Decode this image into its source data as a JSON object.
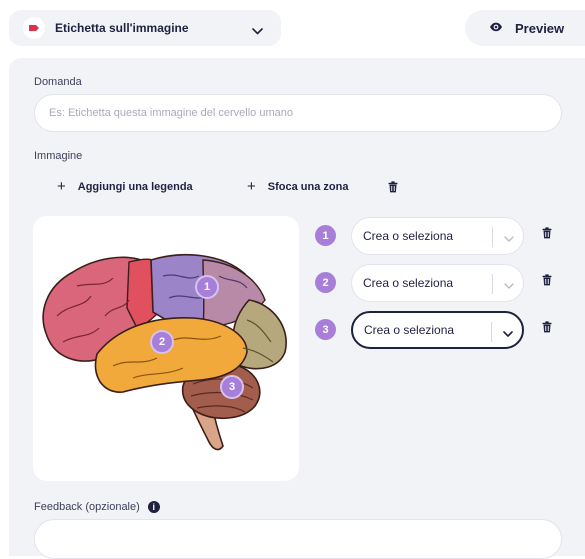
{
  "header": {
    "question_type": {
      "label": "Etichetta sull'immagine",
      "icon": "label-tag-icon"
    },
    "preview": {
      "label": "Preview",
      "icon": "eye-icon"
    }
  },
  "form": {
    "question_label": "Domanda",
    "question_placeholder": "Es: Etichetta questa immagine del cervello umano",
    "question_value": "",
    "image_label": "Immagine",
    "add_legend_label": "Aggiungi una legenda",
    "blur_zone_label": "Sfoca una zona",
    "feedback_label": "Feedback (opzionale)",
    "feedback_value": ""
  },
  "image": {
    "subject": "human brain illustration",
    "markers": [
      "1",
      "2",
      "3"
    ]
  },
  "legends": [
    {
      "number": "1",
      "placeholder": "Crea o seleziona",
      "active": false
    },
    {
      "number": "2",
      "placeholder": "Crea o seleziona",
      "active": false
    },
    {
      "number": "3",
      "placeholder": "Crea o seleziona",
      "active": true
    }
  ],
  "colors": {
    "accent": "#a77fd9",
    "panel": "#f2f3f7",
    "text": "#1f2140",
    "label_icon": "#e0314b"
  }
}
